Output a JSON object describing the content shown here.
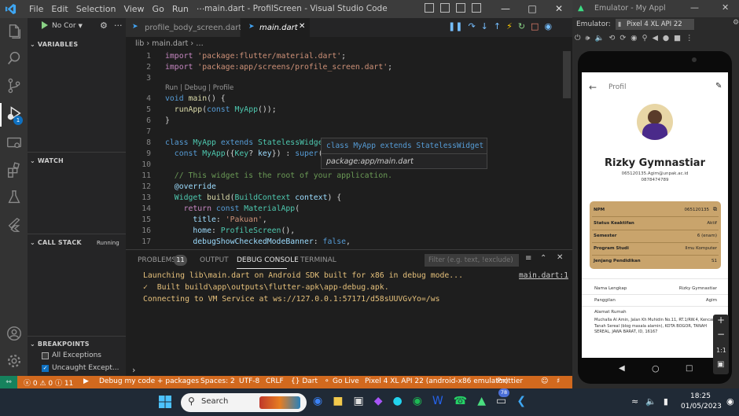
{
  "title": "main.dart - ProfilScreen - Visual Studio Code",
  "menu": [
    "File",
    "Edit",
    "Selection",
    "View",
    "Go",
    "Run",
    "···"
  ],
  "debug": {
    "config": "No Cor",
    "sections": {
      "variables": "VARIABLES",
      "watch": "WATCH",
      "callstack": "CALL STACK",
      "callstack_status": "Running",
      "breakpoints": "BREAKPOINTS"
    },
    "breakpoints": [
      {
        "label": "All Exceptions",
        "checked": false
      },
      {
        "label": "Uncaught Except...",
        "checked": true
      }
    ]
  },
  "activity_badge": "1",
  "tabs": [
    {
      "label": "profile_body_screen.dart",
      "active": false
    },
    {
      "label": "main.dart",
      "active": true
    }
  ],
  "breadcrumb": "lib ›  main.dart › …",
  "codelens": "Run | Debug | Profile",
  "line_numbers": [
    "1",
    "2",
    "3",
    "4",
    "5",
    "6",
    "7",
    "8",
    "9",
    "10",
    "11",
    "12",
    "13",
    "14",
    "15",
    "16",
    "17"
  ],
  "hover": {
    "line1": "class MyApp extends StatelessWidget",
    "line2": "package:app/main.dart"
  },
  "panel": {
    "tabs": [
      "PROBLEMS",
      "OUTPUT",
      "DEBUG CONSOLE",
      "TERMINAL"
    ],
    "problems_count": "11",
    "filter_placeholder": "Filter (e.g. text, !exclude)",
    "lines": [
      "Launching lib\\main.dart on Android SDK built for x86 in debug mode...",
      "✓  Built build\\app\\outputs\\flutter-apk\\app-debug.apk.",
      "Connecting to VM Service at ws://127.0.0.1:57171/d58sUUVGvYo=/ws"
    ],
    "source": "main.dart:1",
    "prompt": "›"
  },
  "status": {
    "errors": "ⓧ 0 ⚠ 0 ⓘ 11",
    "debug": "Debug my code + packages",
    "spaces": "Spaces: 2",
    "encoding": "UTF-8",
    "eol": "CRLF",
    "lang": "{} Dart",
    "golive": "Go Live",
    "device": "Pixel 4 XL API 22 (android-x86 emulator)",
    "prettier": "Prettier"
  },
  "emulator": {
    "window_title": "Emulator - My Appl",
    "label": "Emulator:",
    "device": "Pixel 4 XL API 22"
  },
  "app": {
    "appbar_title": "Profil",
    "name": "Rizky Gymnastiar",
    "email": "065120135.Agim@unpak.ac.id",
    "phone": "0878474789",
    "card": [
      {
        "k": "NPM",
        "v": "065120135"
      },
      {
        "k": "Status Keaktifan",
        "v": "Aktif"
      },
      {
        "k": "Semester",
        "v": "6 (enam)"
      },
      {
        "k": "Program Studi",
        "v": "Ilmu Komputer"
      },
      {
        "k": "Jenjang Pendidikan",
        "v": "S1"
      }
    ],
    "details": [
      {
        "k": "Nama Lengkap",
        "v": "Rizky Gymnastiar"
      },
      {
        "k": "Panggilan",
        "v": "Agim"
      }
    ],
    "address_label": "Alamat Rumah",
    "address": "Muchalla Al Amin, Jalan Kh Muhidin No.11, RT.1/RW.4, Kencana, Tanah Sereal (blog masala alamin), KOTA BOGOR, TANAH SEREAL, JAWA BARAT, ID, 16167"
  },
  "taskbar": {
    "search": "Search",
    "time": "18:25",
    "date": "01/05/2023",
    "badge": "78"
  },
  "colors": {
    "accent": "#d2691e",
    "card": "#c9a46c"
  }
}
